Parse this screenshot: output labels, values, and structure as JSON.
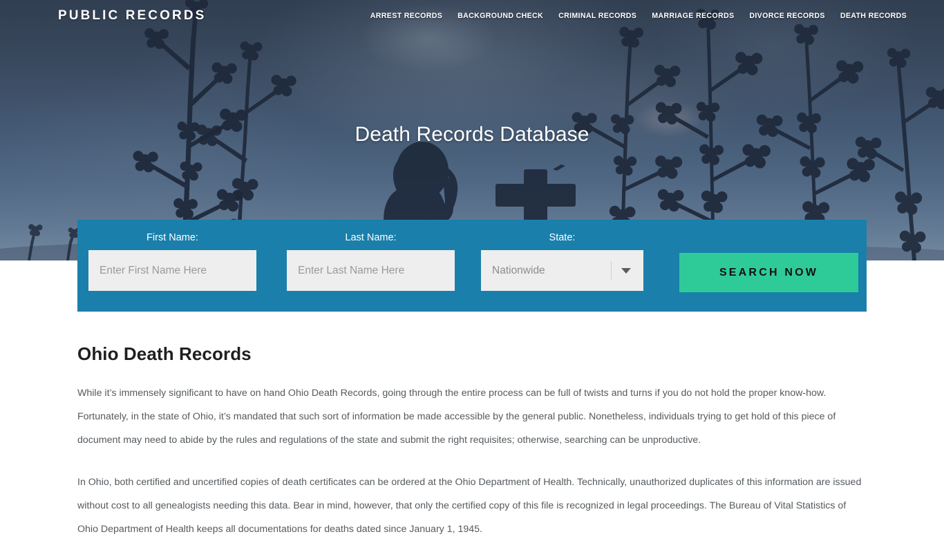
{
  "header": {
    "logo": "PUBLIC RECORDS",
    "nav": [
      {
        "label": "ARREST RECORDS",
        "name": "nav-arrest-records"
      },
      {
        "label": "BACKGROUND CHECK",
        "name": "nav-background-check"
      },
      {
        "label": "CRIMINAL RECORDS",
        "name": "nav-criminal-records"
      },
      {
        "label": "MARRIAGE RECORDS",
        "name": "nav-marriage-records"
      },
      {
        "label": "DIVORCE RECORDS",
        "name": "nav-divorce-records"
      },
      {
        "label": "DEATH RECORDS",
        "name": "nav-death-records"
      }
    ]
  },
  "hero": {
    "title": "Death Records Database"
  },
  "search_form": {
    "first_name_label": "First Name:",
    "first_name_placeholder": "Enter First Name Here",
    "first_name_value": "",
    "last_name_label": "Last Name:",
    "last_name_placeholder": "Enter Last Name Here",
    "last_name_value": "",
    "state_label": "State:",
    "state_value": "Nationwide",
    "submit_label": "SEARCH NOW"
  },
  "main": {
    "title": "Ohio Death Records",
    "paragraph_1": "While it’s immensely significant to have on hand Ohio Death Records, going through the entire process can be full of twists and turns if you do not hold the proper know-how. Fortunately, in the state of Ohio, it’s mandated that such sort of information be made accessible by the general public. Nonetheless, individuals trying to get hold of this piece of document may need to abide by the rules and regulations of the state and submit the right requisites; otherwise, searching can be unproductive.",
    "paragraph_2": "In Ohio, both certified and uncertified copies of death certificates can be ordered at the Ohio Department of Health. Technically, unauthorized duplicates of this information are issued without cost to all genealogists needing this data. Bear in mind, however, that only the certified copy of this file is recognized in legal proceedings. The Bureau of Vital Statistics of Ohio Department of Health keeps all documentations for deaths dated since January 1, 1945."
  },
  "colors": {
    "panel_blue": "#1a7fab",
    "button_green": "#2ecb98",
    "hero_sky": "#4c6480",
    "body_text": "#555a5e"
  }
}
